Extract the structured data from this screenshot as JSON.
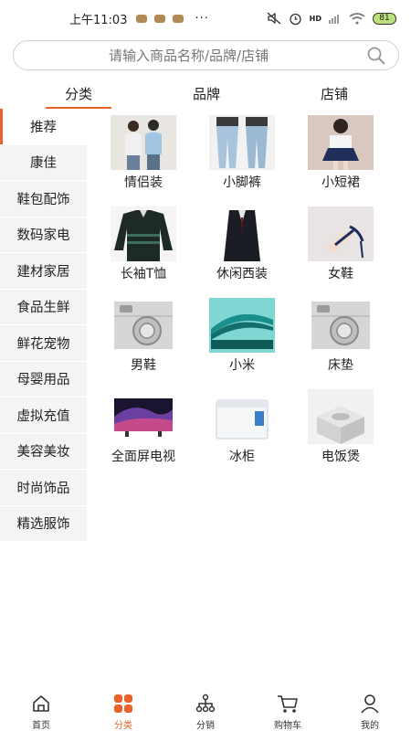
{
  "status_bar": {
    "time": "上午11:03",
    "more": "···",
    "network": "HD",
    "battery": "81"
  },
  "search": {
    "placeholder": "请输入商品名称/品牌/店铺"
  },
  "tabs": [
    {
      "label": "分类",
      "active": true
    },
    {
      "label": "品牌",
      "active": false
    },
    {
      "label": "店铺",
      "active": false
    }
  ],
  "sidebar": {
    "items": [
      {
        "label": "推荐",
        "active": true
      },
      {
        "label": "康佳"
      },
      {
        "label": "鞋包配饰"
      },
      {
        "label": "数码家电"
      },
      {
        "label": "建材家居"
      },
      {
        "label": "食品生鲜"
      },
      {
        "label": "鲜花宠物"
      },
      {
        "label": "母婴用品"
      },
      {
        "label": "虚拟充值"
      },
      {
        "label": "美容美妆"
      },
      {
        "label": "时尚饰品"
      },
      {
        "label": "精选服饰"
      }
    ]
  },
  "products": [
    {
      "label": "情侣装",
      "icon": "couple-outfit-image"
    },
    {
      "label": "小脚裤",
      "icon": "jeans-image"
    },
    {
      "label": "小短裙",
      "icon": "short-skirt-image"
    },
    {
      "label": "长袖T恤",
      "icon": "long-sleeve-tshirt-image"
    },
    {
      "label": "休闲西装",
      "icon": "suit-image"
    },
    {
      "label": "女鞋",
      "icon": "women-shoes-image"
    },
    {
      "label": "男鞋",
      "icon": "placeholder-image"
    },
    {
      "label": "小米",
      "icon": "phone-image"
    },
    {
      "label": "床垫",
      "icon": "placeholder-image"
    },
    {
      "label": "全面屏电视",
      "icon": "tv-image"
    },
    {
      "label": "冰柜",
      "icon": "freezer-image"
    },
    {
      "label": "电饭煲",
      "icon": "rice-cooker-image"
    }
  ],
  "bottom_nav": [
    {
      "label": "首页",
      "icon": "home-icon",
      "active": false
    },
    {
      "label": "分类",
      "icon": "category-icon",
      "active": true
    },
    {
      "label": "分销",
      "icon": "distribution-icon",
      "active": false
    },
    {
      "label": "购物车",
      "icon": "cart-icon",
      "active": false
    },
    {
      "label": "我的",
      "icon": "user-icon",
      "active": false
    }
  ],
  "colors": {
    "accent": "#e8622a",
    "sidebar_bg": "#f4f4f4",
    "text": "#222222"
  }
}
